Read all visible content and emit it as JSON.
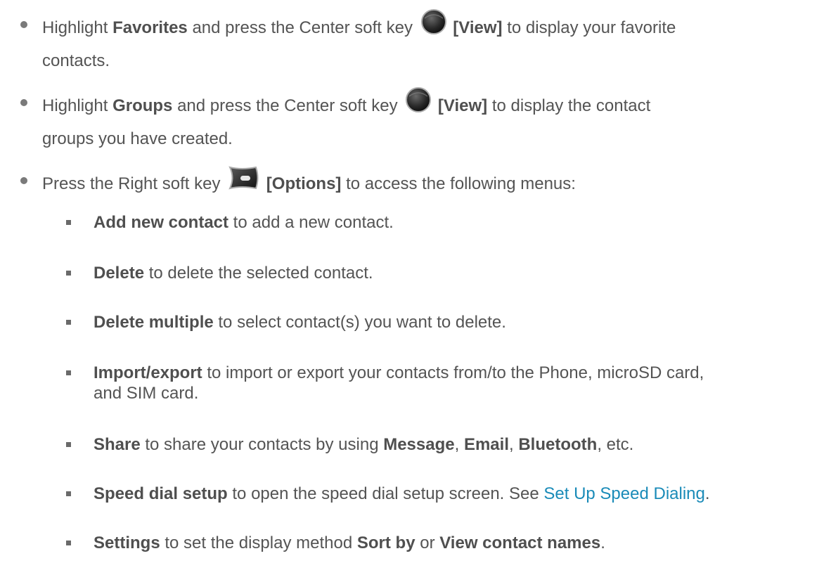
{
  "bullets": [
    {
      "pre": "Highlight ",
      "bold1": "Favorites",
      "mid": " and press the Center soft key ",
      "key_label": "[View]",
      "post": " to display your favorite",
      "line2": "contacts.",
      "icon": "center-soft-key-icon"
    },
    {
      "pre": "Highlight ",
      "bold1": "Groups",
      "mid": " and press the Center soft key ",
      "key_label": "[View]",
      "post": " to display the contact",
      "line2": "groups you have created.",
      "icon": "center-soft-key-icon"
    },
    {
      "pre": "Press the Right soft key ",
      "key_label": "[Options]",
      "post": " to access the following menus:",
      "icon": "right-soft-key-icon"
    }
  ],
  "subitems": [
    {
      "bold": "Add new contact",
      "text": " to add a new contact."
    },
    {
      "bold": "Delete",
      "text": " to delete the selected contact."
    },
    {
      "bold": "Delete multiple",
      "text": " to select contact(s) you want to delete."
    },
    {
      "bold": "Import/export",
      "text": " to import or export your contacts from/to the Phone, microSD card,",
      "line2": "and SIM card."
    },
    {
      "bold": "Share",
      "text": " to share your contacts by using ",
      "b2": "Message",
      "s2": ", ",
      "b3": "Email",
      "s3": ", ",
      "b4": "Bluetooth",
      "s4": ", etc."
    },
    {
      "bold": "Speed dial setup",
      "text": " to open the speed dial setup screen. See ",
      "link": "Set Up Speed Dialing",
      "tail": "."
    },
    {
      "bold": "Settings",
      "text": " to set the display method ",
      "b2": "Sort by",
      "s2": " or ",
      "b3": "View contact names",
      "s3": "."
    }
  ],
  "colors": {
    "body_text": "#545454",
    "link": "#1a8bb8"
  }
}
